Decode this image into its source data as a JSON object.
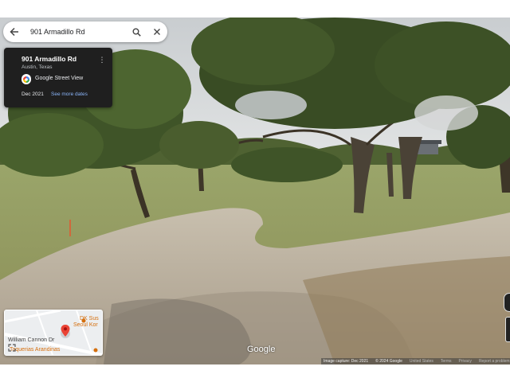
{
  "search": {
    "query": "901 Armadillo Rd"
  },
  "card": {
    "address": "901 Armadillo Rd",
    "city": "Austin, Texas",
    "provider": "Google Street View",
    "date": "Dec 2021",
    "more_dates": "See more dates"
  },
  "minimap": {
    "poi_1": "DK Sus",
    "poi_2": "Seoul Kor",
    "road": "William Cannon Dr",
    "poi_3": "Taquerias Arandinas"
  },
  "watermark": "Google",
  "footer": {
    "capture": "Image capture: Dec 2021",
    "copyright": "© 2024 Google",
    "country": "United States",
    "terms": "Terms",
    "privacy": "Privacy",
    "report": "Report a problem"
  },
  "colors": {
    "card_bg": "#1f1f1f",
    "link": "#8ab4f8",
    "pin": "#ea4335",
    "poi": "#d56e0c"
  },
  "icons": [
    "back-arrow-icon",
    "search-icon",
    "close-icon",
    "more-vert-icon",
    "street-view-logo-icon",
    "map-pin-icon",
    "fullscreen-icon",
    "compass-icon",
    "zoom-icon"
  ]
}
